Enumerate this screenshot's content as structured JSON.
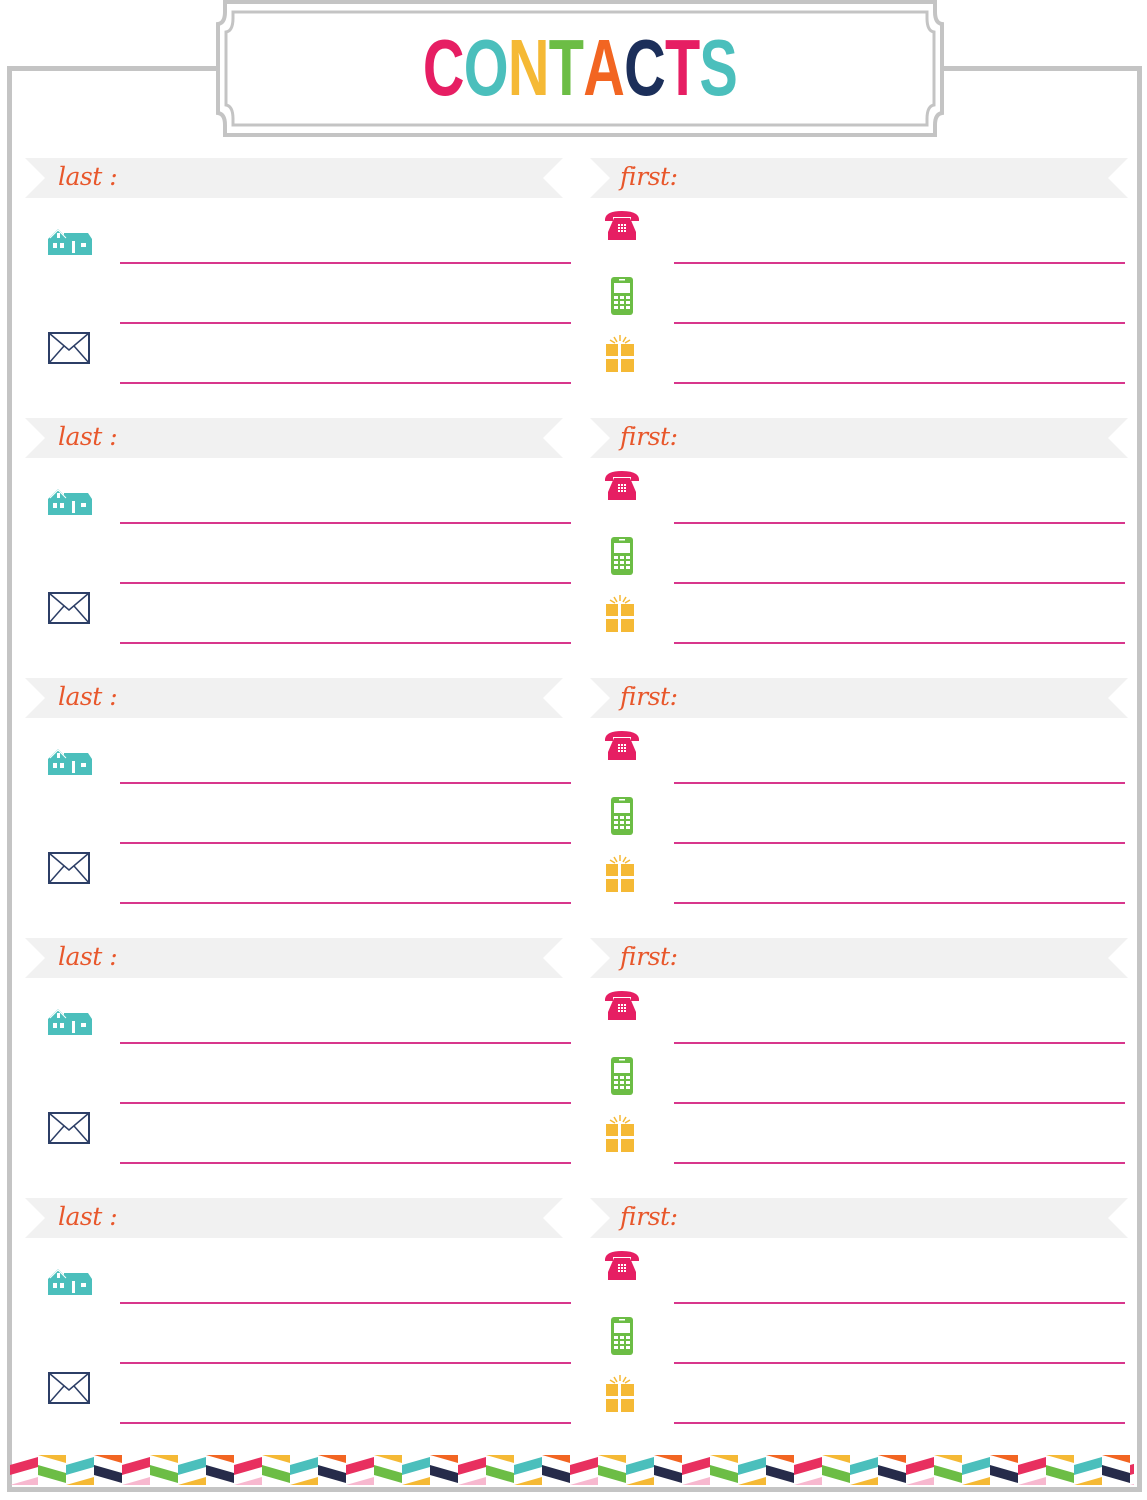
{
  "page": {
    "title_letters": [
      {
        "char": "C",
        "color": "#e61e63"
      },
      {
        "char": "O",
        "color": "#4bbfbc"
      },
      {
        "char": "N",
        "color": "#f5b935"
      },
      {
        "char": "T",
        "color": "#6cbd45"
      },
      {
        "char": "A",
        "color": "#f26522"
      },
      {
        "char": "C",
        "color": "#1c2f5a"
      },
      {
        "char": "T",
        "color": "#e61e63"
      },
      {
        "char": "S",
        "color": "#4bbfbc"
      }
    ],
    "title_text": "CONTACTS"
  },
  "colors": {
    "frame": "#c4c4c4",
    "banner": "#f1f1f1",
    "label": "#e8572b",
    "line": "#d8368c",
    "home": "#4bbfbc",
    "mail": "#2c3e66",
    "phone": "#e61e63",
    "mobile": "#6cbd45",
    "gift": "#f5b935"
  },
  "contacts": [
    {
      "last_label": "last :",
      "first_label": "first:",
      "left_icons": [
        "home-icon",
        "mail-icon"
      ],
      "right_icons": [
        "phone-icon",
        "mobile-icon",
        "gift-icon"
      ]
    },
    {
      "last_label": "last :",
      "first_label": "first:",
      "left_icons": [
        "home-icon",
        "mail-icon"
      ],
      "right_icons": [
        "phone-icon",
        "mobile-icon",
        "gift-icon"
      ]
    },
    {
      "last_label": "last :",
      "first_label": "first:",
      "left_icons": [
        "home-icon",
        "mail-icon"
      ],
      "right_icons": [
        "phone-icon",
        "mobile-icon",
        "gift-icon"
      ]
    },
    {
      "last_label": "last :",
      "first_label": "first:",
      "left_icons": [
        "home-icon",
        "mail-icon"
      ],
      "right_icons": [
        "phone-icon",
        "mobile-icon",
        "gift-icon"
      ]
    },
    {
      "last_label": "last :",
      "first_label": "first:",
      "left_icons": [
        "home-icon",
        "mail-icon"
      ],
      "right_icons": [
        "phone-icon",
        "mobile-icon",
        "gift-icon"
      ]
    }
  ],
  "footer_strip": {
    "pattern": "herringbone",
    "colors": [
      "#e8305f",
      "#f5b935",
      "#4bbfbc",
      "#f26522",
      "#6cbd45",
      "#262b4a",
      "#f7b8cf"
    ]
  }
}
